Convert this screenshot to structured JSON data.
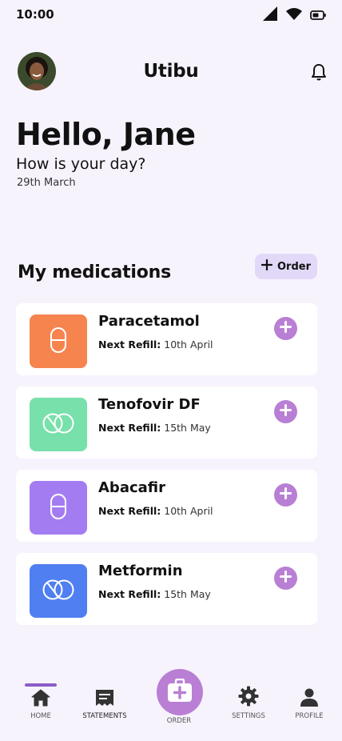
{
  "status": {
    "time": "10:00"
  },
  "header": {
    "brand": "Utibu"
  },
  "greeting": {
    "title": "Hello, Jane",
    "subtitle": "How is your day?",
    "date": "29th March"
  },
  "medications": {
    "title": "My medications",
    "order_label": "Order",
    "refill_label": "Next Refill:",
    "items": [
      {
        "name": "Paracetamol",
        "refill": "10th April",
        "color": "#f5844f",
        "icon": "capsule-icon"
      },
      {
        "name": "Tenofovir DF",
        "refill": "15th May",
        "color": "#78e0aa",
        "icon": "split-tablet-icon"
      },
      {
        "name": "Abacafir",
        "refill": "10th April",
        "color": "#a47cf2",
        "icon": "capsule-icon"
      },
      {
        "name": "Metformin",
        "refill": "15th May",
        "color": "#4f7ff0",
        "icon": "split-tablet-icon"
      }
    ]
  },
  "nav": {
    "home": "HOME",
    "statements": "STATEMENTS",
    "order": "ORDER",
    "settings": "SETTINGS",
    "profile": "PROFILE"
  },
  "colors": {
    "accent": "#b97fd4",
    "background": "#f7f3fd",
    "indicator": "#8b5cc8"
  }
}
